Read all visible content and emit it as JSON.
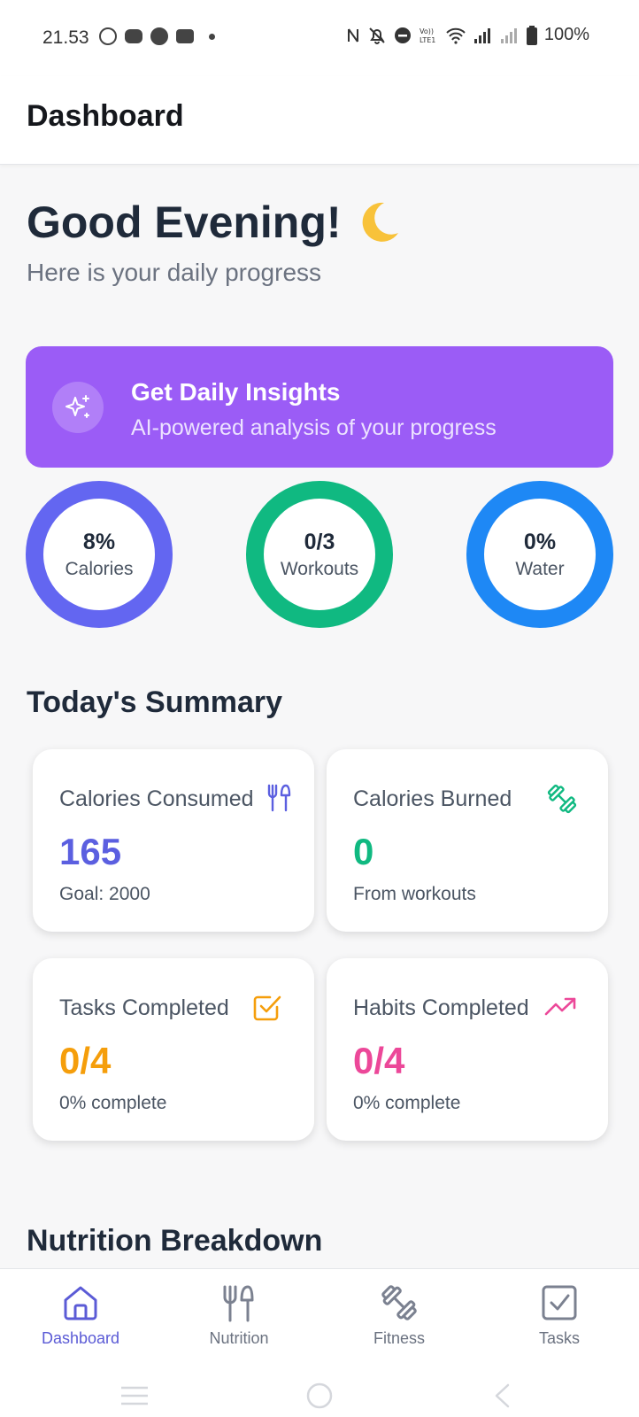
{
  "status_bar": {
    "time": "21.53",
    "battery": "100%",
    "notification_icons": [
      "whatsapp-icon",
      "discord-icon",
      "spotify-icon",
      "chat-icon"
    ],
    "system_icons": [
      "nfc-icon",
      "mute-icon",
      "dnd-icon",
      "volte-icon",
      "wifi-icon",
      "signal-icon",
      "signal-weak-icon",
      "battery-icon"
    ]
  },
  "header": {
    "title": "Dashboard"
  },
  "greeting": {
    "title": "Good Evening!",
    "emoji_icon": "moon-icon",
    "subtitle": "Here is your daily progress"
  },
  "insights": {
    "title": "Get Daily Insights",
    "subtitle": "AI-powered analysis of your progress",
    "icon": "sparkles-icon",
    "color": "#9b5cf6"
  },
  "progress_rings": [
    {
      "value": "8%",
      "label": "Calories",
      "color": "#6366f1"
    },
    {
      "value": "0/3",
      "label": "Workouts",
      "color": "#10b981"
    },
    {
      "value": "0%",
      "label": "Water",
      "color": "#1e88f5"
    }
  ],
  "summary": {
    "title": "Today's Summary",
    "cards": [
      {
        "label": "Calories Consumed",
        "value": "165",
        "sub": "Goal: 2000",
        "icon": "fork-knife-icon",
        "color": "#5b5fe0"
      },
      {
        "label": "Calories Burned",
        "value": "0",
        "sub": "From workouts",
        "icon": "dumbbell-icon",
        "color": "#10b981"
      },
      {
        "label": "Tasks Completed",
        "value": "0/4",
        "sub": "0% complete",
        "icon": "checkbox-icon",
        "color": "#f59e0b"
      },
      {
        "label": "Habits Completed",
        "value": "0/4",
        "sub": "0% complete",
        "icon": "trending-up-icon",
        "color": "#ec4899"
      }
    ]
  },
  "nutrition": {
    "title": "Nutrition Breakdown"
  },
  "bottom_nav": {
    "items": [
      {
        "label": "Dashboard",
        "icon": "home-icon",
        "active": true
      },
      {
        "label": "Nutrition",
        "icon": "fork-knife-icon",
        "active": false
      },
      {
        "label": "Fitness",
        "icon": "dumbbell-icon",
        "active": false
      },
      {
        "label": "Tasks",
        "icon": "checkbox-icon",
        "active": false
      }
    ],
    "active_color": "#5b5bd6"
  }
}
